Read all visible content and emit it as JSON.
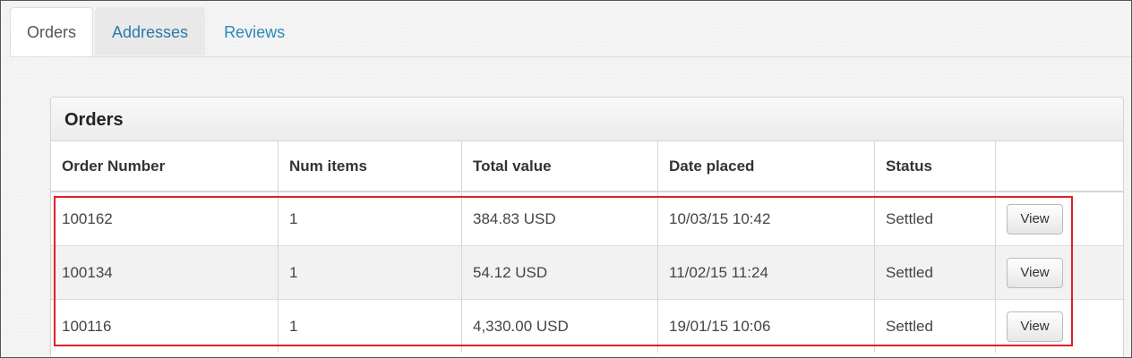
{
  "tabs": [
    {
      "label": "Orders"
    },
    {
      "label": "Addresses"
    },
    {
      "label": "Reviews"
    }
  ],
  "panel": {
    "title": "Orders",
    "columns": [
      "Order Number",
      "Num items",
      "Total value",
      "Date placed",
      "Status",
      ""
    ],
    "rows": [
      {
        "order_number": "100162",
        "num_items": "1",
        "total_value": "384.83 USD",
        "date_placed": "10/03/15 10:42",
        "status": "Settled",
        "action": "View"
      },
      {
        "order_number": "100134",
        "num_items": "1",
        "total_value": "54.12 USD",
        "date_placed": "11/02/15 11:24",
        "status": "Settled",
        "action": "View"
      },
      {
        "order_number": "100116",
        "num_items": "1",
        "total_value": "4,330.00 USD",
        "date_placed": "19/01/15 10:06",
        "status": "Settled",
        "action": "View"
      }
    ]
  },
  "colors": {
    "link": "#2a8ab8",
    "highlight_border": "#e0202a"
  }
}
